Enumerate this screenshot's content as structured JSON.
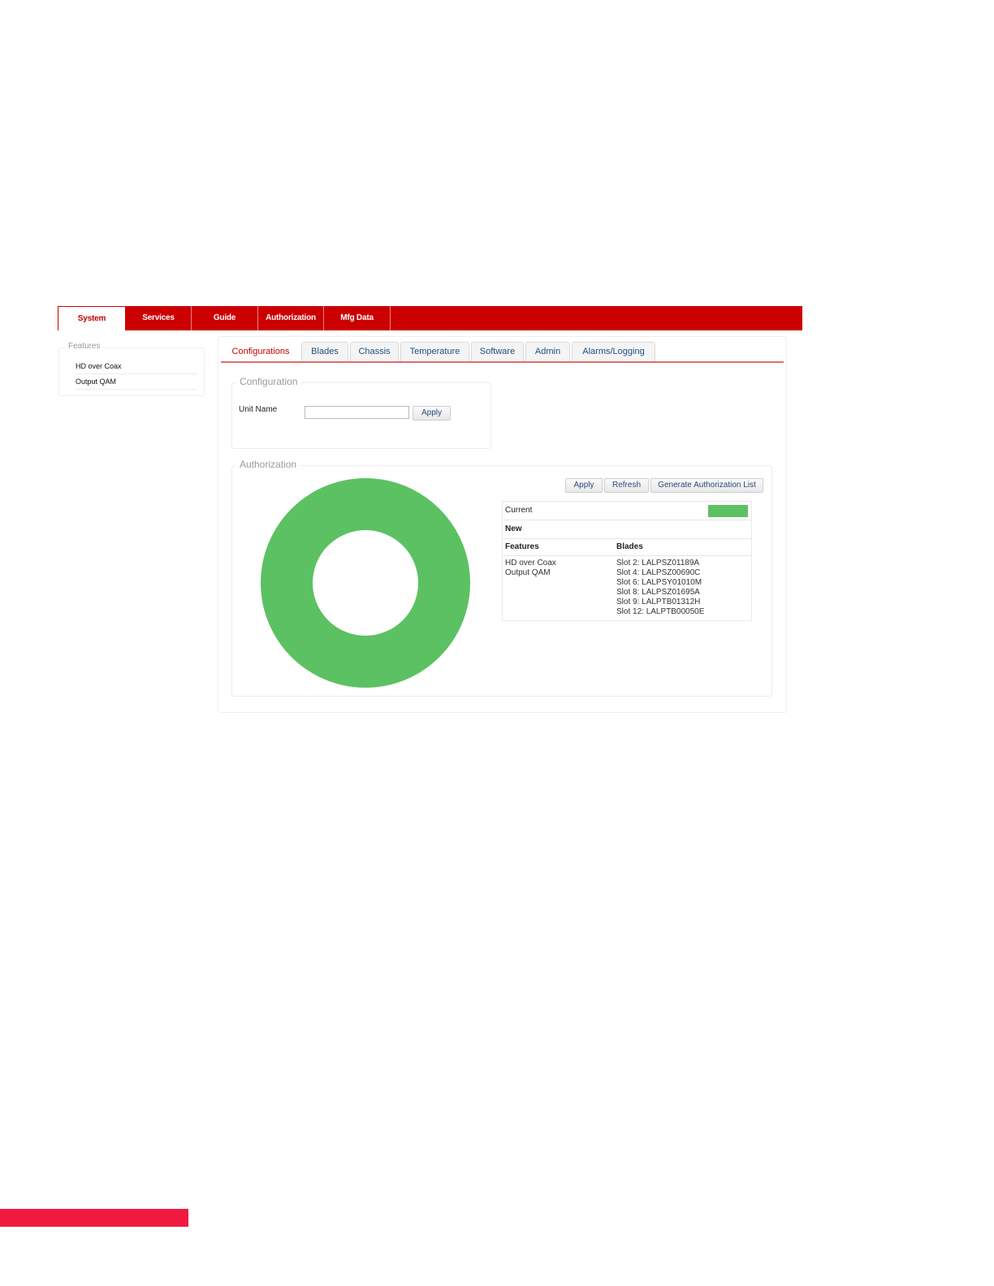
{
  "nav": {
    "tabs": [
      "System",
      "Services",
      "Guide",
      "Authorization",
      "Mfg Data"
    ],
    "active": "System"
  },
  "sidebar": {
    "legend": "Features",
    "items": [
      "HD over Coax",
      "Output QAM"
    ]
  },
  "subtabs": {
    "items": [
      "Configurations",
      "Blades",
      "Chassis",
      "Temperature",
      "Software",
      "Admin",
      "Alarms/Logging"
    ],
    "active": "Configurations"
  },
  "configuration": {
    "legend": "Configuration",
    "unit_name_label": "Unit Name",
    "unit_name_value": "",
    "apply_label": "Apply"
  },
  "authorization": {
    "legend": "Authorization",
    "buttons": {
      "apply": "Apply",
      "refresh": "Refresh",
      "generate": "Generate Authorization List"
    },
    "current_label": "Current",
    "new_label": "New",
    "features_header": "Features",
    "blades_header": "Blades",
    "features": [
      "HD over Coax",
      "Output QAM"
    ],
    "blades": [
      "Slot 2: LALPSZ01189A",
      "Slot 4: LALPSZ00690C",
      "Slot 6: LALPSY01010M",
      "Slot 8: LALPSZ01695A",
      "Slot 9: LALPTB01312H",
      "Slot 12: LALPTB00050E"
    ],
    "current_color": "#5cc162",
    "donut_color": "#5cc162"
  },
  "colors": {
    "brand_red": "#cc0000",
    "footer_bar": "#f0193f"
  }
}
